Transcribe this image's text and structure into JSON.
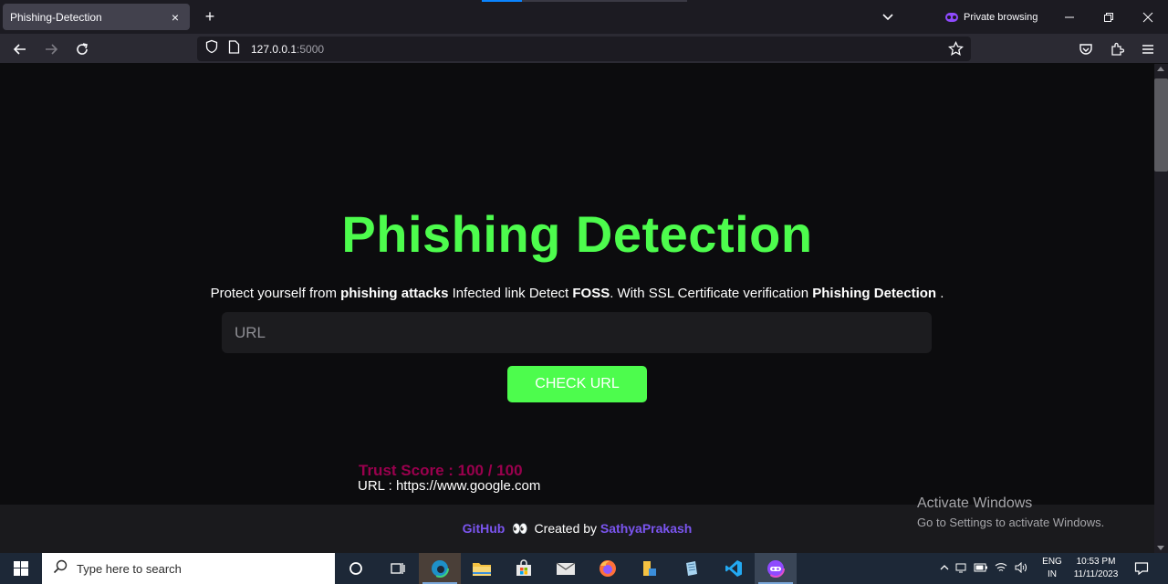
{
  "browser": {
    "tab_title": "Phishing-Detection",
    "tab_close": "×",
    "new_tab": "+",
    "private_label": "Private browsing",
    "url_host": "127.0.0.1",
    "url_port": ":5000"
  },
  "page": {
    "heading": "Phishing Detection",
    "tagline": {
      "t1": "Protect yourself from ",
      "b1": "phishing attacks",
      "t2": " Infected link Detect ",
      "b2": "FOSS",
      "t3": ". With SSL Certificate verification ",
      "b3": "Phishing Detection",
      "t4": " ."
    },
    "url_placeholder": "URL",
    "check_button": "CHECK URL",
    "trust_score": "Trust Score : 100 / 100",
    "url_result": "URL : https://www.google.com"
  },
  "footer": {
    "github": "GitHub",
    "eyes": "👀",
    "created_by": "Created by",
    "author": "SathyaPrakash"
  },
  "watermark": {
    "line1": "Activate Windows",
    "line2": "Go to Settings to activate Windows."
  },
  "taskbar": {
    "search_placeholder": "Type here to search",
    "lang_1": "ENG",
    "lang_2": "IN",
    "time": "10:53 PM",
    "date": "11/11/2023"
  },
  "colors": {
    "accent_green": "#4dfc4d",
    "trust_score": "#99004d",
    "footer_link": "#7b55f0"
  }
}
